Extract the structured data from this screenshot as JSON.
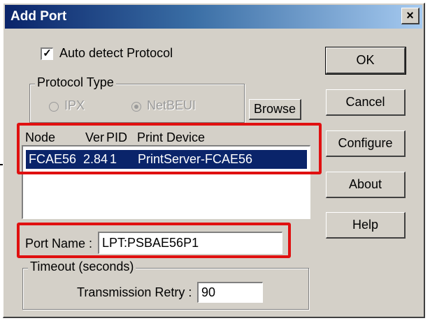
{
  "dialog": {
    "title": "Add Port",
    "close_label": "×"
  },
  "auto_detect": {
    "label": "Auto detect Protocol",
    "checked": true,
    "check_glyph": "✓"
  },
  "protocol_type": {
    "title": "Protocol Type",
    "options": [
      {
        "label": "IPX",
        "selected": false
      },
      {
        "label": "NetBEUI",
        "selected": true
      }
    ]
  },
  "buttons": {
    "browse": "Browse",
    "ok": "OK",
    "cancel": "Cancel",
    "configure": "Configure",
    "about": "About",
    "help": "Help"
  },
  "device_list": {
    "columns": [
      "Node",
      "Ver",
      "PID",
      "Print Device"
    ],
    "rows": [
      {
        "node": "FCAE56",
        "ver": "2.84",
        "pid": "1",
        "device": "PrintServer-FCAE56",
        "selected": true
      }
    ]
  },
  "port_name": {
    "label": "Port Name :",
    "value": "LPT:PSBAE56P1"
  },
  "timeout": {
    "title": "Timeout (seconds)",
    "retry_label": "Transmission Retry :",
    "retry_value": "90"
  },
  "colors": {
    "highlight": "#e01010",
    "selection": "#0a246a",
    "dialog_bg": "#d4d0c8"
  }
}
